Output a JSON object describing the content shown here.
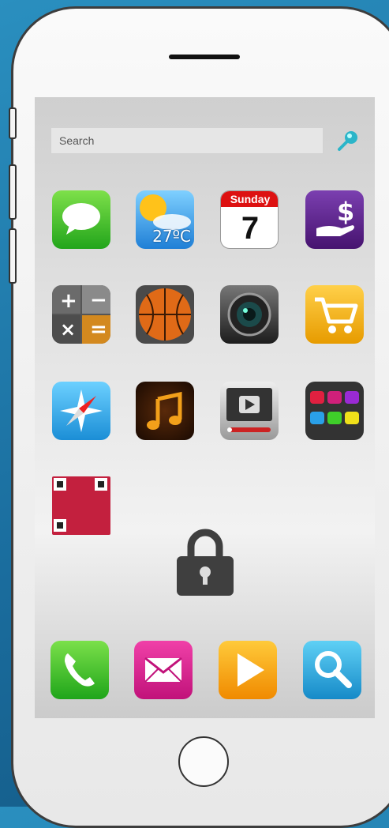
{
  "search": {
    "placeholder": "Search"
  },
  "apps": [
    {
      "name": "messages",
      "label": ""
    },
    {
      "name": "weather",
      "temperature": "27ºC"
    },
    {
      "name": "calendar",
      "day": "Sunday",
      "date": "7"
    },
    {
      "name": "payments",
      "symbol": "$"
    },
    {
      "name": "calculator"
    },
    {
      "name": "basketball"
    },
    {
      "name": "camera"
    },
    {
      "name": "shopping"
    },
    {
      "name": "compass"
    },
    {
      "name": "music"
    },
    {
      "name": "video"
    },
    {
      "name": "apps-grid"
    },
    {
      "name": "qr-code"
    }
  ],
  "dock": [
    "phone",
    "mail",
    "play",
    "search"
  ],
  "colors": {
    "background": "#1a6d9e",
    "screen": "#e4e4e4",
    "phone_body": "#f4f4f4"
  }
}
